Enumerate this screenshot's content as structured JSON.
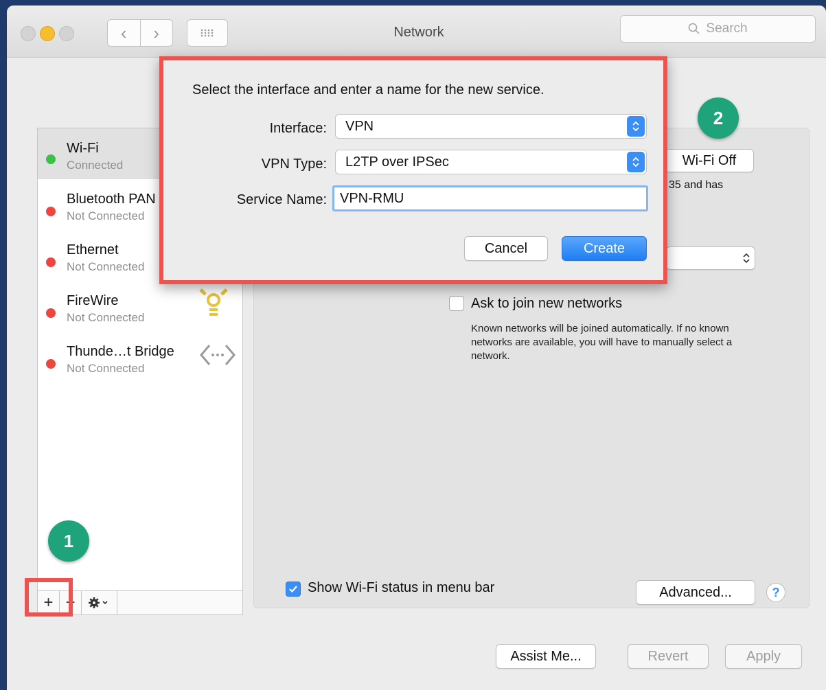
{
  "window": {
    "title": "Network"
  },
  "toolbar": {
    "search_placeholder": "Search"
  },
  "services": [
    {
      "name": "Wi-Fi",
      "status": "Connected",
      "color": "#3cc146",
      "selected": true
    },
    {
      "name": "Bluetooth PAN",
      "status": "Not Connected",
      "color": "#ee4540",
      "selected": false
    },
    {
      "name": "Ethernet",
      "status": "Not Connected",
      "color": "#ee4540",
      "selected": false
    },
    {
      "name": "FireWire",
      "status": "Not Connected",
      "color": "#ee4540",
      "selected": false
    },
    {
      "name": "Thunde…t Bridge",
      "status": "Not Connected",
      "color": "#ee4540",
      "selected": false
    }
  ],
  "panel": {
    "wifi_off_button": "Wi-Fi Off",
    "status_partial": "35 and has",
    "ask_join_label": "Ask to join new networks",
    "ask_join_help": "Known networks will be joined automatically. If no known networks are available, you will have to manually select a network.",
    "show_status_label": "Show Wi-Fi status in menu bar",
    "advanced_button": "Advanced...",
    "help_button": "?"
  },
  "footer": {
    "assist_button": "Assist Me...",
    "revert_button": "Revert",
    "apply_button": "Apply"
  },
  "dialog": {
    "prompt": "Select the interface and enter a name for the new service.",
    "interface_label": "Interface:",
    "interface_value": "VPN",
    "vpn_type_label": "VPN Type:",
    "vpn_type_value": "L2TP over IPSec",
    "service_name_label": "Service Name:",
    "service_name_value": "VPN-RMU",
    "cancel_button": "Cancel",
    "create_button": "Create"
  },
  "annotations": {
    "step1": "1",
    "step2": "2"
  },
  "colors": {
    "accent": "#3a8ef6",
    "highlight": "#ef5350",
    "badge": "#1fa37b"
  }
}
